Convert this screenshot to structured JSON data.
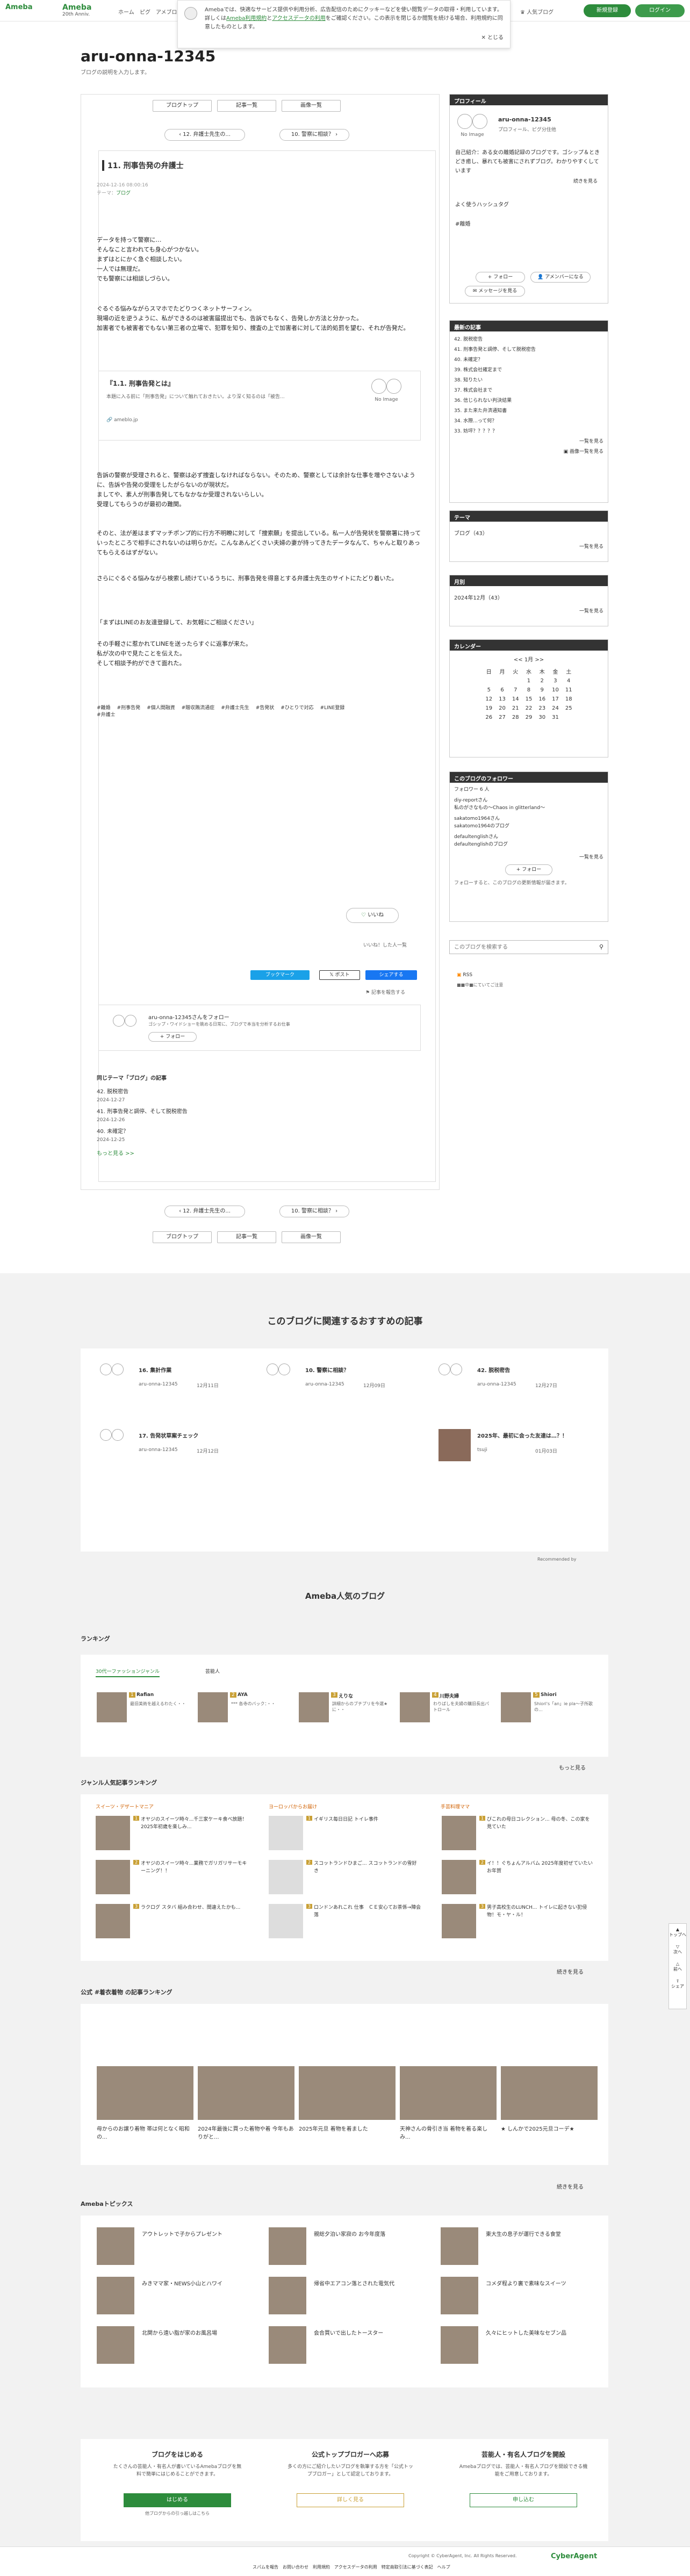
{
  "header": {
    "logo": "Ameba",
    "logo2_title": "Ameba",
    "logo2_sub": "20th Anniv.",
    "nav": [
      "ホーム",
      "ピグ",
      "アメブロ"
    ],
    "ranking": "人気ブログ",
    "register": "新規登録",
    "login": "ログイン"
  },
  "cookie": {
    "text1": "Amebaでは、快適なサービス提供や利用分析、広告配信のためにクッキーなどを使い閲覧データの取得・利用しています。詳しくは",
    "link1": "Ameba利用規約",
    "and": "と",
    "link2": "アクセスデータの利用",
    "text2": "をご確認ください。この表示を閉じるか閲覧を続ける場合、利用規約に同意したものとします。",
    "close": "とじる"
  },
  "blog": {
    "title": "aru-onna-12345",
    "subtitle": "ブログの説明を入力します。"
  },
  "pager": {
    "top": "ブログトップ",
    "list": "記事一覧",
    "images": "画像一覧",
    "prev": "12. 弁護士先生の...",
    "next": "10. 警察に相談？"
  },
  "post": {
    "title": "11. 刑事告発の弁護士",
    "date": "2024-12-16 08:00:16",
    "theme_label": "テーマ：",
    "theme": "ブログ",
    "p1": [
      "データを持って警察に…",
      "そんなこと言われても身心がつかない。",
      "まずはとにかく急ぐ相談したい。",
      "一人では無理だ。",
      "でも警察には相談しづらい。"
    ],
    "p2": [
      "ぐるぐる悩みながらスマホでたどりつくネットサーフィン。",
      "現場の近を逆うように、私ができるのは被害届提出でも、告訴でもなく、告発しか方法と分かった。",
      "加害者でも被害者でもない第三者の立場で、犯罪を知り、捜査の上で加害者に対して法的処罰を望む、それが告発だ。"
    ],
    "card_title": "『1.1. 刑事告発とは』",
    "card_desc": "本題に入る前に「刑事告発」について触れておきたい。より深く知るのは「被告...",
    "card_src": "ameblo.jp",
    "noimage": "No Image",
    "p3": [
      "告訴の警察が受理されると、警察は必ず捜査しなければならない。そのため、警察としては余計な仕事を増やさないように、告訴や告発の受理をしたがらないのが現状だ。",
      "ましてや、素人が刑事告発してもなかなか受理されないらしい。",
      "受理してもらうのが最初の難関。"
    ],
    "p4": [
      "そのと、法が差はまずマッチポンプ的に行方不明瞭に対して「捜索願」を提出している。私一人が告発状を警察署に持っていったところで相手にされないのは明らかだ。こんなあんどくさい夫婦の妻が持ってきたデータなんて、ちゃんと取りあってもらえるはずがない。"
    ],
    "p5": [
      "さらにぐるぐる悩みながら検索し続けているうちに、刑事告発を得意とする弁護士先生のサイトにたどり着いた。"
    ],
    "p6": [
      "「まずはLINEのお友達登録して、お気軽にご相談ください」"
    ],
    "p7": [
      "その手軽さに惹かれてLINEを送ったらすぐに返事が来た。",
      "私が次の中で見たことを伝えた。",
      "そして相談予約ができて面れた。"
    ],
    "tags": [
      "#離婚",
      "#刑事告発",
      "#個人間融資",
      "#贈収賄流通症",
      "#弁護士先生",
      "#告発状",
      "#ひとりで対応",
      "#LINE登録",
      "#弁護士"
    ],
    "like": "いいね",
    "like_list": "いいね！した人一覧",
    "share1": "ブックマーク",
    "share2": "ポスト",
    "share3": "シェアする",
    "report": "記事を報告する",
    "author_line": "aru-onna-12345さんをフォロー",
    "author_desc": "ゴシップ・ワイドショーを眺める日常に、ブログで本当を分析するお仕事",
    "follow": "フォロー"
  },
  "same_theme": {
    "title": "同じテーマ「ブログ」の記事",
    "items": [
      {
        "t": "42. 脱税密告",
        "d": "2024-12-27"
      },
      {
        "t": "41. 刑事告発と調停、そして脱税密告",
        "d": "2024-12-26"
      },
      {
        "t": "40. 未確定？",
        "d": "2024-12-25"
      }
    ],
    "more": "もっと見る >>"
  },
  "profile": {
    "head": "プロフィール",
    "name": "aru-onna-12345",
    "desc": "プロフィール、ピグ分住他",
    "intro": "自己紹介：ある女の離婚記録のブログです。ゴシップ＆ときどき癒し、暴れても被害にされずブログ。わかりやすくしています",
    "more": "続きを見る",
    "hashtag_title": "よく使うハッシュタグ",
    "hashtag": "#離婚",
    "follow": "フォロー",
    "amember": "アメンバーになる",
    "message": "メッセージを見る",
    "noimage": "No Image"
  },
  "recent": {
    "head": "最新の記事",
    "items": [
      "42. 脱税密告",
      "41. 刑事告発と調停、そして脱税密告",
      "40. 未確定？",
      "39. 株式会社確定まで",
      "38. 知りたい",
      "37. 株式会社まで",
      "36. 信じられない判決結果",
      "35. また来た弁済通知書",
      "34. 水際...って何？",
      "33. 妨坪？？？？？"
    ],
    "more": "一覧を見る",
    "img_more": "画像一覧を見る"
  },
  "theme": {
    "head": "テーマ",
    "item": "ブログ（43）",
    "more": "一覧を見る"
  },
  "month": {
    "head": "月別",
    "item": "2024年12月（43）",
    "more": "一覧を見る"
  },
  "calendar": {
    "head": "カレンダー",
    "label": "1月",
    "days": [
      "日",
      "月",
      "火",
      "水",
      "木",
      "金",
      "土"
    ],
    "rows": [
      [
        "",
        "",
        "",
        "1",
        "2",
        "3",
        "4"
      ],
      [
        "5",
        "6",
        "7",
        "8",
        "9",
        "10",
        "11"
      ],
      [
        "12",
        "13",
        "14",
        "15",
        "16",
        "17",
        "18"
      ],
      [
        "19",
        "20",
        "21",
        "22",
        "23",
        "24",
        "25"
      ],
      [
        "26",
        "27",
        "28",
        "29",
        "30",
        "31",
        ""
      ]
    ]
  },
  "followers": {
    "head": "このブログのフォロワー",
    "count": "フォロワー 6 人",
    "items": [
      {
        "n": "diy-reportさん",
        "d": "私のがさなもの～Chaos in glitterland～"
      },
      {
        "n": "sakatomo1964さん",
        "d": "sakatomo1964のブログ"
      },
      {
        "n": "defaultenglishさん",
        "d": "defaultenglishのブログ"
      }
    ],
    "more": "一覧を見る",
    "follow": "フォロー",
    "note": "フォローすると、このブログの更新情報が届きます。"
  },
  "search": {
    "placeholder": "このブログを検索する",
    "rss": "RSS",
    "rss_note": "■■中■にていてご注意"
  },
  "recommend": {
    "title": "このブログに関連するおすすめの記事",
    "items": [
      {
        "t": "16. 集計作業",
        "a": "aru-onna-12345",
        "d": "12月11日"
      },
      {
        "t": "10. 警察に相談？",
        "a": "aru-onna-12345",
        "d": "12月09日"
      },
      {
        "t": "42. 脱税密告",
        "a": "aru-onna-12345",
        "d": "12月27日"
      },
      {
        "t": "17. 告発状草案チェック",
        "a": "aru-onna-12345",
        "d": "12月12日"
      },
      {
        "t": "",
        "a": "",
        "d": ""
      },
      {
        "t": "2025年、最初に会った友達は…？！",
        "a": "tsuji",
        "d": "01月03日"
      }
    ],
    "powered": "Recommended by"
  },
  "popular": {
    "title": "Ameba人気のブログ",
    "ranking": "ランキング",
    "tab1": "30代一ファッションジャンル",
    "tab2": "芸能人",
    "rank": [
      {
        "n": "Rafian",
        "t": "最旧美術を越えるわたく・・"
      },
      {
        "n": "AYA",
        "t": "*** 各寺のバック：・・"
      },
      {
        "n": "えりな",
        "t": "詳細からのブチプリを今選★に・・"
      },
      {
        "n": "川野夫婦",
        "t": "わりばしを夫婦の購旧長出パトロール"
      },
      {
        "n": "Shiori",
        "t": "Shiori's「an」ie pla～子所歌の..."
      }
    ],
    "more": "もっと見る",
    "genre_title": "ジャンル人気記事ランキング",
    "g1": "スイーツ・デザートマニア",
    "g2": "ヨーロッパからお届け",
    "g3": "手芸料理ママ",
    "g1items": [
      "オヤジのスイーツ時々...千三家ケーキ食べ放題！2025年初歳を楽しみ...",
      "オヤジのスイーツ時々...業務でガリガリサーモキーニング！！",
      "ラクログ スタバ 組み合わせ、間違えたかも..."
    ],
    "g2items": [
      "イギリス毎日日記 トイレ事件",
      "スコットランドひまご... スコットランドの雪好き",
      "ロンドンあれこれ 仕事　ＣＥ安心てお茶係→陣会落"
    ],
    "g3items": [
      "びこれの母日コレクション... 母の冬、この家を見ていた",
      "イ！！ぐちょんアルバム 2025年度初ぜていたいお年賀",
      "男子高校生のLUNCH... トイレに起きない犯侵物！モ・ヤ・ル！"
    ],
    "more2": "続きを見る",
    "official": "公式 #着衣着物 の記事ランキング",
    "officialitems": [
      "母からのお譲り着物 帯は何となく昭和の...",
      "2024年最後に買った着物や着 今年もありがと...",
      "2025年元旦 着物を着ました",
      "天神さんの骨引き当 着物を着る楽しみ...",
      "★ しんかで2025元旦コーデ★"
    ],
    "topics": "Amebaトピックス",
    "topicitems": [
      "アウトレットで子からプレゼント",
      "親総夕泊い家寂の お今年度落",
      "東大生の息子が運行できる食堂",
      "みきママ家・NEWS小山とハワイ",
      "帰省中エアコン落とされた電気代",
      "コメダ程より裏で素味なスイーツ",
      "北関から遠い脂が家のお風呂場",
      "会合買いで出したトースター",
      "久々にヒットした美味なセブン品"
    ]
  },
  "bottom": {
    "b1": "ブログをはじめる",
    "b1d": "たくさんの芸能人・有名人が書いているAmebaブログを無料で簡単にはじめることができます。",
    "b1btn": "はじめる",
    "b1s": "他ブログからの引っ越しはこちら",
    "b2": "公式トップブロガーへ応募",
    "b2d": "多くの方にご紹介したいブログを執筆する方を「公式トップブロガー」として認定しております。",
    "b2btn": "詳しく見る",
    "b3": "芸能人・有名人ブログを開設",
    "b3d": "Amebaブログでは、芸能人・有名人ブログを開設できる機能をご用意しております。",
    "b3btn": "申し込む"
  },
  "footer": {
    "links": [
      "スパムを報告",
      "お問い合わせ",
      "利用規約",
      "アクセスデータの利用",
      "特定商取引法に基づく表記",
      "ヘルプ"
    ],
    "copy": "Copyright © CyberAgent, Inc. All Rights Reserved.",
    "brand": "CyberAgent"
  },
  "scroll": {
    "top": "トップへ",
    "next": "次へ",
    "prev": "前へ",
    "share": "シェア"
  }
}
